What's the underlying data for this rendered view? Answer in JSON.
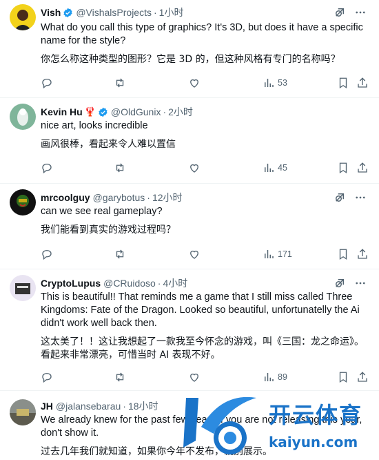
{
  "tweets": [
    {
      "name": "Vish",
      "verified": true,
      "handle": "@VishalsProjects",
      "time": "1小时",
      "text": "What do you call this type of graphics? It's 3D, but does it have a specific name for the style?",
      "translation": "你怎么称这种类型的图形？它是 3D 的，但这种风格有专门的名称吗？",
      "views": "53"
    },
    {
      "name": "Kevin Hu",
      "emoji": "🦞",
      "verified": true,
      "handle": "@OldGunix",
      "time": "2小时",
      "text": "nice art, looks incredible",
      "translation": "画风很棒，看起来令人难以置信",
      "views": "45"
    },
    {
      "name": "mrcoolguy",
      "verified": false,
      "handle": "@garybotus",
      "time": "12小时",
      "text": "can we see real gameplay?",
      "translation": "我们能看到真实的游戏过程吗？",
      "views": "171"
    },
    {
      "name": "CryptoLupus",
      "verified": false,
      "handle": "@CRuidoso",
      "time": "4小时",
      "text": "This is beautiful!! That reminds me a game that I still miss called Three Kingdoms: Fate of the Dragon. Looked so beautiful, unfortunatelly the Ai didn't work well back then.",
      "translation": "这太美了！！这让我想起了一款我至今怀念的游戏，叫《三国：龙之命运》。看起来非常漂亮，可惜当时 AI 表现不好。",
      "views": "89"
    },
    {
      "name": "JH",
      "verified": false,
      "handle": "@jalansebarau",
      "time": "18小时",
      "text": "We already knew for the past few years if you are not releasing this year, don't show it.",
      "translation": "过去几年我们就知道，如果你今年不发布，就别展示。"
    }
  ],
  "watermark": {
    "cn": "开云体育",
    "en": "kaiyun.com"
  },
  "colors": {
    "verified": "#1d9bf0",
    "muted": "#536471",
    "divider": "#eff3f4",
    "watermark": "#1a73c8"
  }
}
